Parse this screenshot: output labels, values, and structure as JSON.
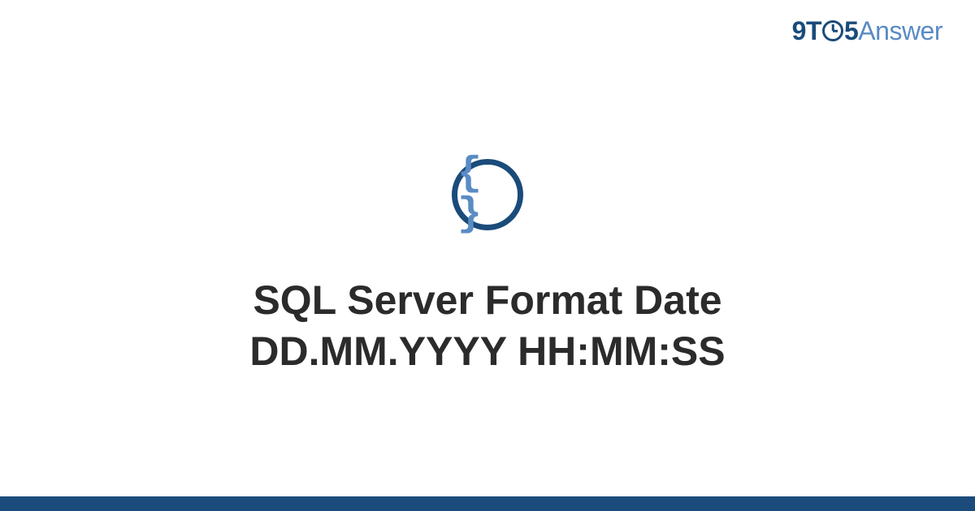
{
  "logo": {
    "prefix": "9T",
    "suffix": "5",
    "word": "Answer"
  },
  "icon": {
    "symbol": "{ }",
    "name": "code-braces-icon"
  },
  "title": {
    "line1": "SQL Server Format Date",
    "line2": "DD.MM.YYYY HH:MM:SS"
  },
  "colors": {
    "primary": "#1a4b7a",
    "secondary": "#5a8bc4",
    "text": "#2b2b2b"
  }
}
